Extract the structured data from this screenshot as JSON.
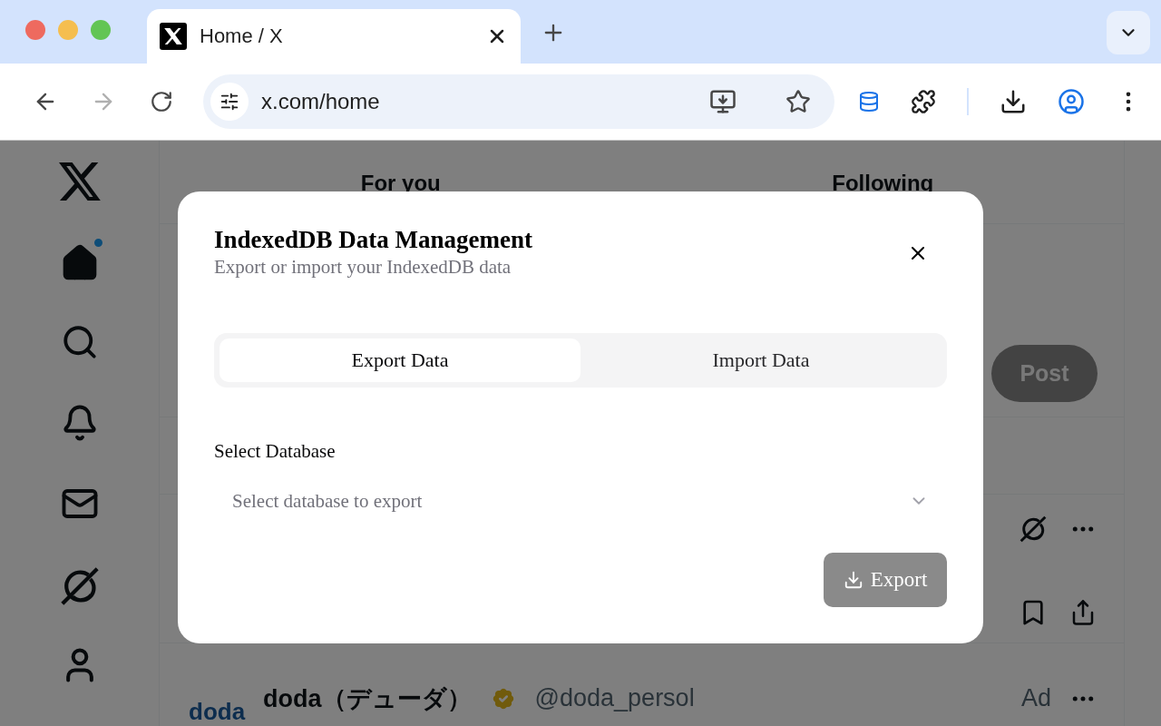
{
  "browser": {
    "tabs": [
      {
        "title": "Home / X",
        "selected": true
      }
    ],
    "address": "x.com/home",
    "forward_disabled": true
  },
  "page": {
    "feed_tabs": [
      {
        "label": "For you"
      },
      {
        "label": "Following"
      }
    ],
    "home_notification": true,
    "post_button": "Post",
    "ad": {
      "logo": "doda",
      "name": "doda（デューダ）",
      "handle": "@doda_persol",
      "label": "Ad"
    }
  },
  "dialog": {
    "title": "IndexedDB Data Management",
    "subtitle": "Export or import your IndexedDB data",
    "tabs": [
      {
        "label": "Export Data",
        "selected": true
      },
      {
        "label": "Import Data",
        "selected": false
      }
    ],
    "field_label": "Select Database",
    "select": {
      "placeholder": "Select database to export"
    },
    "export_button": {
      "label": "Export",
      "disabled": true
    }
  }
}
